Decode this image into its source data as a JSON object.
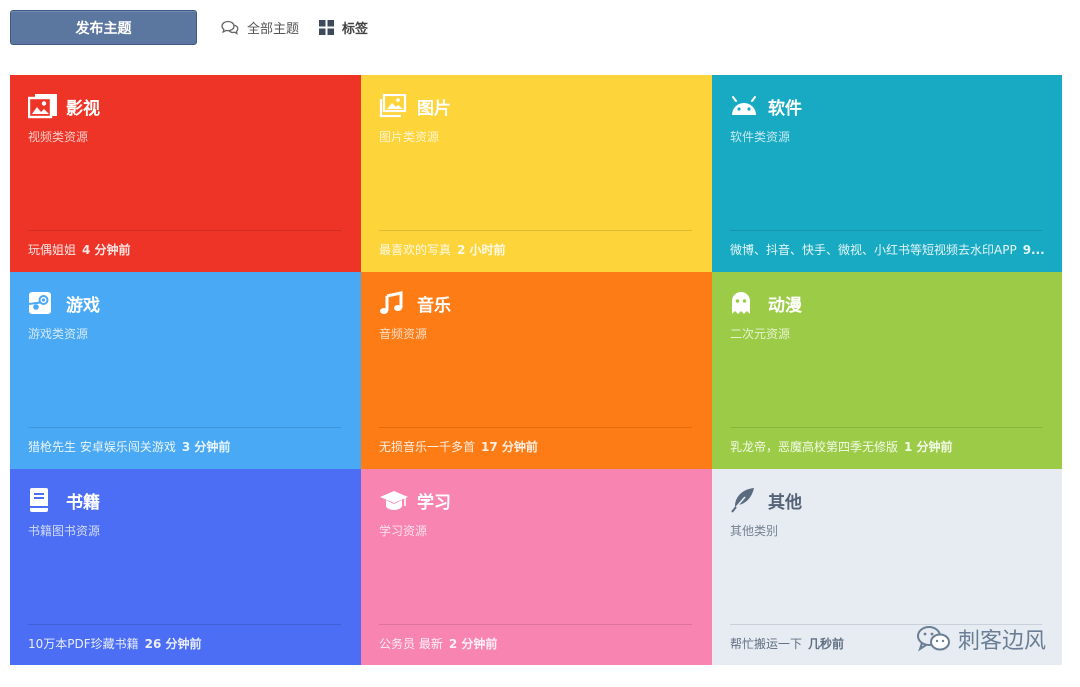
{
  "toolbar": {
    "post_label": "发布主题",
    "all_label": "全部主题",
    "tags_label": "标签"
  },
  "tiles": [
    {
      "name": "影视",
      "desc": "视频类资源",
      "latest": "玩偶姐姐",
      "time": "4 分钟前",
      "color": "#ee3427",
      "icon": "image-icon"
    },
    {
      "name": "图片",
      "desc": "图片类资源",
      "latest": "最喜欢的写真",
      "time": "2 小时前",
      "color": "#fed43b",
      "icon": "photo-icon"
    },
    {
      "name": "软件",
      "desc": "软件类资源",
      "latest": "微博、抖音、快手、微视、小红书等短视频去水印APP",
      "time": "9...",
      "color": "#18aac2",
      "icon": "android-icon"
    },
    {
      "name": "游戏",
      "desc": "游戏类资源",
      "latest": "猎枪先生 安卓娱乐闯关游戏",
      "time": "3 分钟前",
      "color": "#4aa9f4",
      "icon": "steam-icon"
    },
    {
      "name": "音乐",
      "desc": "音频资源",
      "latest": "无损音乐一千多首",
      "time": "17 分钟前",
      "color": "#fd7c16",
      "icon": "music-icon"
    },
    {
      "name": "动漫",
      "desc": "二次元资源",
      "latest": "乳龙帝，恶魔高校第四季无修版",
      "time": "1 分钟前",
      "color": "#9ccc47",
      "icon": "ghost-icon"
    },
    {
      "name": "书籍",
      "desc": "书籍图书资源",
      "latest": "10万本PDF珍藏书籍",
      "time": "26 分钟前",
      "color": "#4b6ef4",
      "icon": "book-icon"
    },
    {
      "name": "学习",
      "desc": "学习资源",
      "latest": "公务员 最新",
      "time": "2 分钟前",
      "color": "#f884b1",
      "icon": "graduation-cap-icon"
    },
    {
      "name": "其他",
      "desc": "其他类别",
      "latest": "帮忙搬运一下",
      "time": "几秒前",
      "color": "#e7ebf2",
      "icon": "feather-icon"
    }
  ],
  "watermark": {
    "text": "刺客边风",
    "icon": "wechat-icon"
  }
}
